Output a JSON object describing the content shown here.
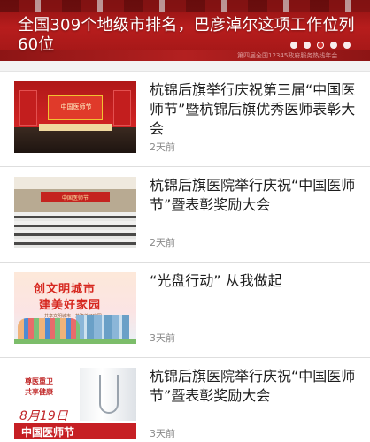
{
  "banner": {
    "title": "全国309个地级市排名，巴彦淖尔这项工作位列60位",
    "caption": "第四届全国12345政府服务热线年会",
    "slide_count": 5,
    "active_slide": 2
  },
  "news": [
    {
      "title": "杭锦后旗举行庆祝第三届“中国医师节”暨杭锦后旗优秀医师表彰大会",
      "time": "2天前",
      "thumb": {
        "screen_text": "中国医师节"
      }
    },
    {
      "title": "杭锦后旗医院举行庆祝“中国医师节”暨表彰奖励大会",
      "time": "2天前",
      "thumb": {
        "banner_text": "中国医师节"
      }
    },
    {
      "title": "“光盘行动”  从我做起",
      "time": "3天前",
      "thumb": {
        "line1": "创文明城市",
        "line2": "建美好家园",
        "sub": "共享文明城市 · 共建美好家园"
      }
    },
    {
      "title": "杭锦后旗医院举行庆祝“中国医师节”暨表彰奖励大会",
      "time": "3天前",
      "thumb": {
        "slogan1": "尊医重卫",
        "slogan2": "共享健康",
        "date": "8月19日",
        "band": "中国医师节"
      }
    }
  ],
  "colors": {
    "banner_red": "#b71d1d",
    "active_dot": "#d0302f",
    "divider": "#dedede",
    "time_gray": "#8a8a8a"
  }
}
